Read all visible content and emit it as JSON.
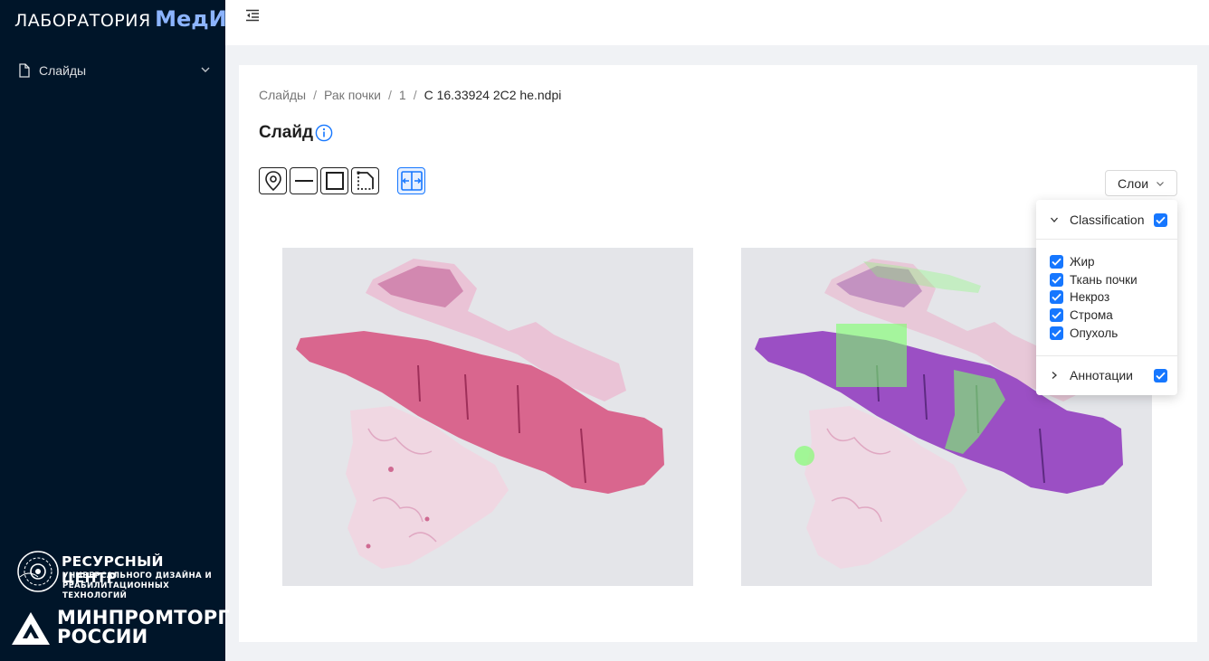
{
  "sidebar": {
    "logo_prefix": "ЛАБОРАТОРИЯ",
    "logo_brand": "МедИИ",
    "menu": [
      {
        "label": "Слайды",
        "icon": "file-icon"
      }
    ],
    "resource_center": {
      "title": "РЕСУРСНЫЙ ЦЕНТР",
      "line1": "УНИВЕРСАЛЬНОГО ДИЗАЙНА И",
      "line2": "РЕАБИЛИТАЦИОННЫХ ТЕХНОЛОГИЙ"
    },
    "ministry": {
      "line1": "МИНПРОМТОРГ",
      "line2": "РОССИИ"
    }
  },
  "breadcrumb": [
    "Слайды",
    "Рак почки",
    "1",
    "C 16.33924 2C2 he.ndpi"
  ],
  "page": {
    "title": "Слайд"
  },
  "toolbar": {
    "tools": [
      "marker-tool",
      "line-tool",
      "rectangle-tool",
      "polygon-tool",
      "compare-tool"
    ],
    "layers_button": "Слои"
  },
  "layers_panel": {
    "classification": {
      "label": "Classification",
      "checked": true,
      "expanded": true
    },
    "classes": [
      {
        "label": "Жир",
        "checked": true
      },
      {
        "label": "Ткань почки",
        "checked": true
      },
      {
        "label": "Некроз",
        "checked": true
      },
      {
        "label": "Строма",
        "checked": true
      },
      {
        "label": "Опухоль",
        "checked": true
      }
    ],
    "annotations": {
      "label": "Аннотации",
      "checked": true,
      "expanded": false
    }
  },
  "colors": {
    "sidebar_bg": "#001529",
    "accent": "#1677ff",
    "brand": "#8cb4ff",
    "tissue_he": "#d9668e",
    "tissue_overlay": "#9b4fc4",
    "overlay_green": "#7cff6a"
  }
}
